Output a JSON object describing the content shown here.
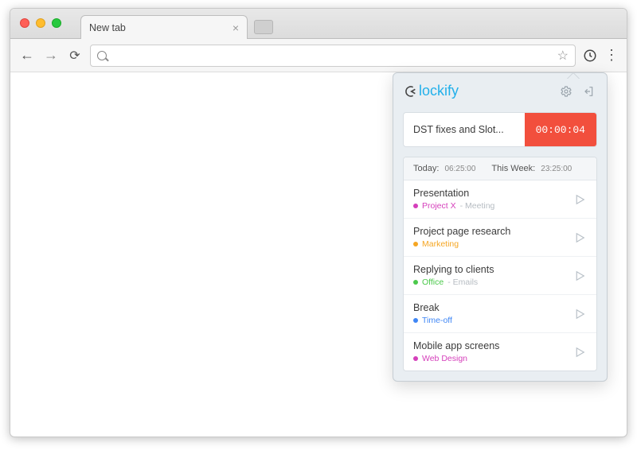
{
  "browser": {
    "tab_title": "New tab",
    "omnibox_value": "",
    "back_enabled": true,
    "forward_enabled": false
  },
  "popup": {
    "brand": "lockify",
    "current": {
      "description": "DST fixes and Slot...",
      "elapsed": "00:00:04"
    },
    "summary": {
      "today_label": "Today:",
      "today_value": "06:25:00",
      "week_label": "This Week:",
      "week_value": "23:25:00"
    },
    "entries": [
      {
        "title": "Presentation",
        "project": "Project X",
        "client": "Meeting",
        "color": "#d53fbb"
      },
      {
        "title": "Project page research",
        "project": "Marketing",
        "client": "",
        "color": "#f5a623"
      },
      {
        "title": "Replying to clients",
        "project": "Office",
        "client": "Emails",
        "color": "#4bc94b"
      },
      {
        "title": "Break",
        "project": "Time-off",
        "client": "",
        "color": "#3f86f5"
      },
      {
        "title": "Mobile app screens",
        "project": "Web Design",
        "client": "",
        "color": "#d53fbb"
      }
    ]
  }
}
